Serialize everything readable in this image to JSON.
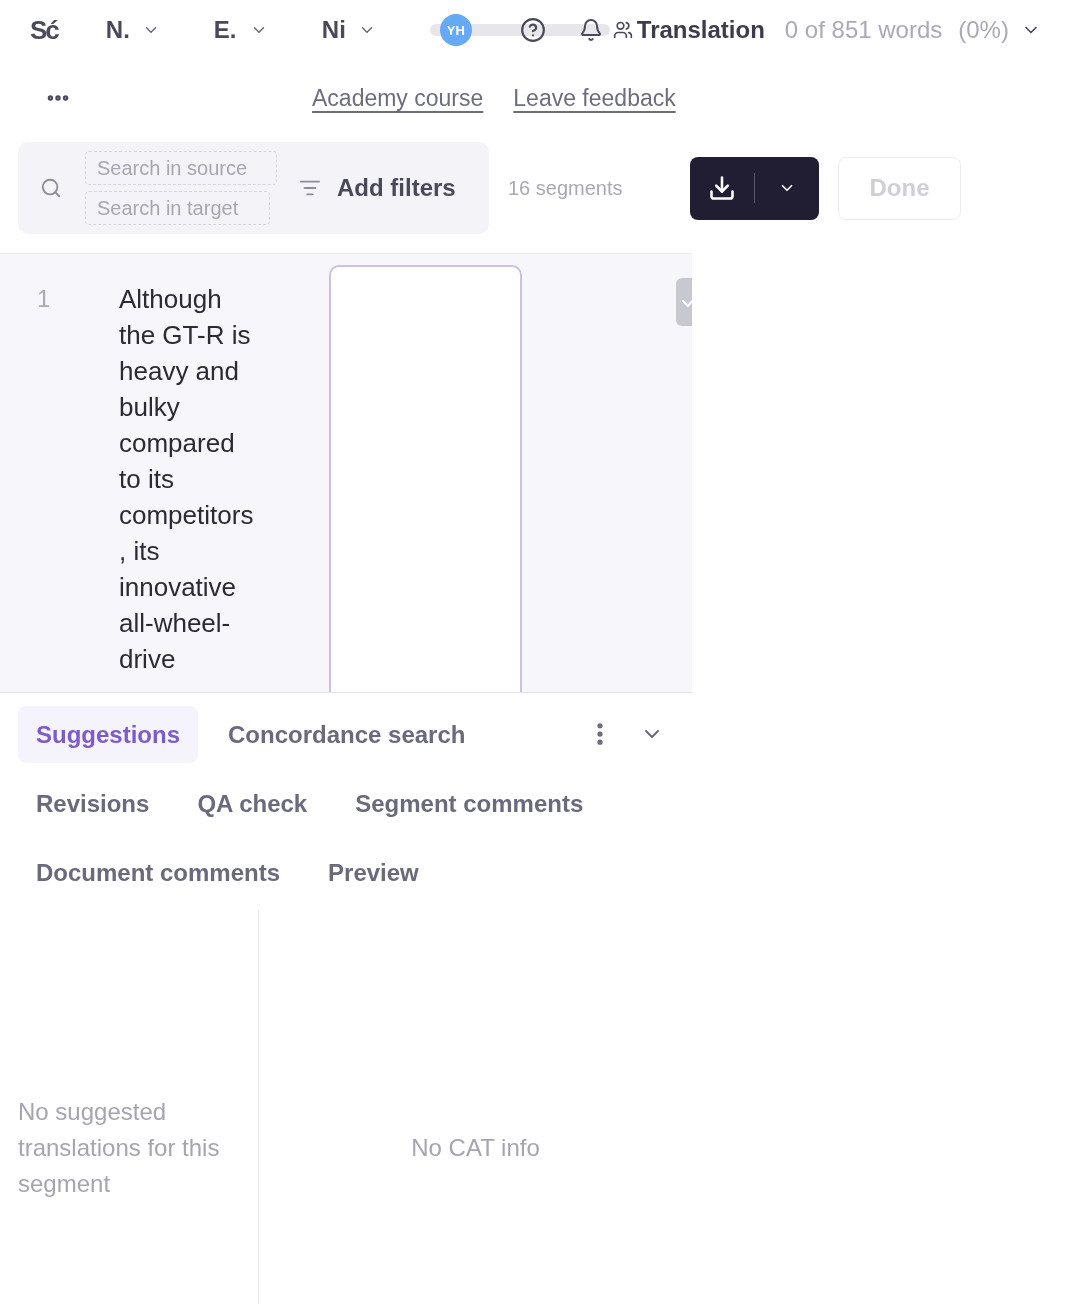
{
  "top_bar": {
    "logo": "Sć",
    "dropdowns": [
      {
        "label": "N."
      },
      {
        "label": "E."
      },
      {
        "label": "Ni"
      }
    ],
    "avatar": "YH",
    "stage": "Translation",
    "progress": "0 of 851 words",
    "percent": "(0%)"
  },
  "links": [
    "Academy course",
    "Leave feedback"
  ],
  "toolbar": {
    "search_fields": [
      {
        "placeholder": "Search in source"
      },
      {
        "placeholder": "Search in target"
      }
    ],
    "filters_button": "Add filters",
    "segment_count": "16 segments",
    "done_button": {
      "label": "Done",
      "disabled": true
    }
  },
  "segments": [
    {
      "number": "1",
      "source": "Although the GT-R is heavy and bulky compared to its competitors , its innovative all-wheel-drive",
      "selected": true
    }
  ],
  "panel": {
    "tabs": [
      {
        "label": "Suggestions",
        "selected": true
      },
      {
        "label": "Concordance search",
        "selected": false
      },
      {
        "label": "Revisions",
        "selected": false
      },
      {
        "label": "QA check",
        "selected": false
      },
      {
        "label": "Segment comments",
        "selected": false
      },
      {
        "label": "Document comments",
        "selected": false
      },
      {
        "label": "Preview",
        "selected": false
      }
    ],
    "suggestions_message": "No suggested translations for this segment",
    "cat_info_message": "No CAT info"
  }
}
